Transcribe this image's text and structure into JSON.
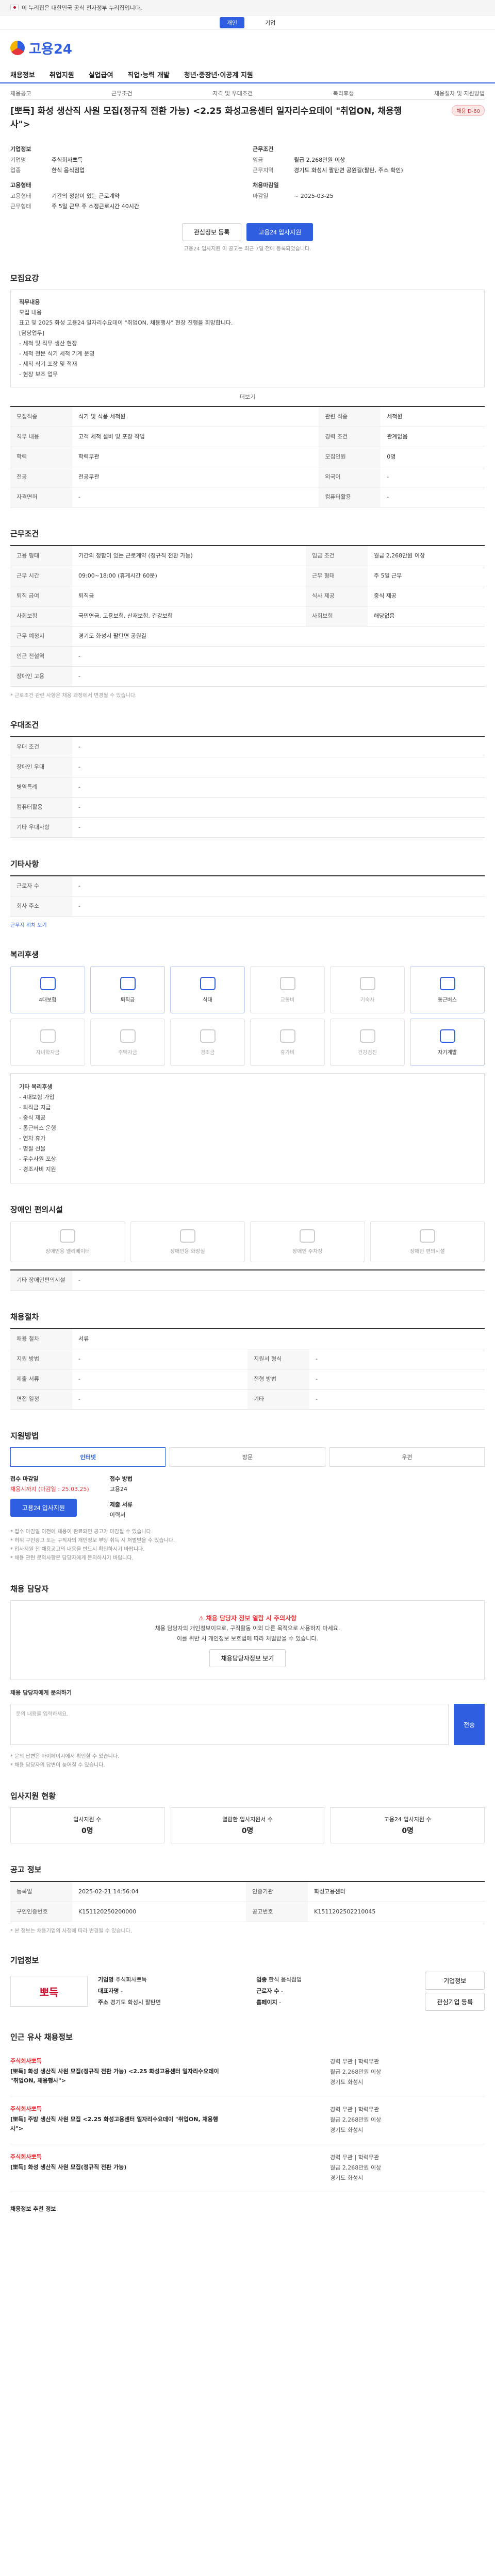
{
  "govbar": {
    "text": "이 누리집은 대한민국 공식 전자정부 누리집입니다."
  },
  "toggle": {
    "left": "개인",
    "right": "기업"
  },
  "logo": {
    "text": "고용24"
  },
  "nav": [
    "채용정보",
    "취업지원",
    "실업급여",
    "직업·능력 개발",
    "청년·중장년·이공계 지원"
  ],
  "top_tabs": [
    "채용공고",
    "근무조건",
    "자격 및 우대조건",
    "복리후생",
    "채용절차 및 지원방법"
  ],
  "job": {
    "title": "[뽀득] 화성 생산직 사원 모집(정규직 전환 가능) <2.25 화성고용센터 일자리수요데이 \"취업ON, 채용행사\">",
    "badge": "채용 D-60",
    "company_label": "기업정보",
    "company": [
      {
        "k": "기업명",
        "v": "주식회사뽀득"
      },
      {
        "k": "업종",
        "v": "한식 음식점업"
      }
    ],
    "cond_label": "근무조건",
    "cond": [
      {
        "k": "임금",
        "v": "월급 2,268만원 이상"
      },
      {
        "k": "근무지역",
        "v": "경기도 화성시 팔탄면 공원길(팔탄, 주소 확인)"
      }
    ],
    "recruit_label": "고용형태",
    "recruit": [
      {
        "k": "고용형태",
        "v": "기간의 정함이 있는 근로계약"
      },
      {
        "k": "근무형태",
        "v": "주 5일 근무 주 소정근로시간 40시간"
      }
    ],
    "deadline_label": "채용마감일",
    "deadline": [
      {
        "k": "마감일",
        "v": "~ 2025-03-25"
      }
    ]
  },
  "buttons": {
    "scrap": "관심정보 등록",
    "apply": "고용24 입사지원",
    "note": "고용24 입사지원 이 공고는 최근 7일 전에 등록되었습니다."
  },
  "detail": {
    "title": "모집요강",
    "sub": "직무내용",
    "lines": [
      "모집 내용",
      "표고 및 2025 화성 고용24 일자리수요데이 \"취업ON, 채용행사\" 현장 진행을 희망합니다.",
      "[담당업무]",
      "- 세척 및 직무 생산 현장",
      "- 세척 전문 식기 세척 기계 운영",
      "- 세척 식기 포장 및 적재",
      "- 현장 보조 업무"
    ],
    "more": "더보기"
  },
  "recruit_table": {
    "rows": [
      {
        "k": "모집직종",
        "v": "식기 및 식품 세척원",
        "k2": "관련 직종",
        "v2": "세척원"
      },
      {
        "k": "직무 내용",
        "v": "고객 세척 설비 및 포장 작업",
        "k2": "경력 조건",
        "v2": "관계없음"
      },
      {
        "k": "학력",
        "v": "학력무관",
        "k2": "모집인원",
        "v2": "0명"
      },
      {
        "k": "전공",
        "v": "전공무관",
        "k2": "외국어",
        "v2": "-"
      },
      {
        "k": "자격면허",
        "v": "-",
        "k2": "컴퓨터활용",
        "v2": "-"
      }
    ]
  },
  "work": {
    "title": "근무조건",
    "rows": [
      {
        "k": "고용 형태",
        "v": "기간의 정함이 있는 근로계약 (정규직 전환 가능)",
        "k2": "임금 조건",
        "v2": "월급 2,268만원 이상"
      },
      {
        "k": "근무 시간",
        "v": "09:00~18:00 (휴게시간 60분)",
        "k2": "근무 형태",
        "v2": "주 5일 근무"
      },
      {
        "k": "퇴직 급여",
        "v": "퇴직금",
        "k2": "식사 제공",
        "v2": "중식 제공"
      },
      {
        "k": "사회보험",
        "v": "국민연금, 고용보험, 산재보험, 건강보험",
        "k2": "사회보험",
        "v2": "해당없음"
      },
      {
        "k": "근무 예정지",
        "v": "경기도 화성시 팔탄면 공원길",
        "k2": "",
        "v2": ""
      },
      {
        "k": "인근 전철역",
        "v": "-",
        "k2": "",
        "v2": ""
      },
      {
        "k": "장애인 고용",
        "v": "-",
        "k2": "",
        "v2": ""
      }
    ],
    "note": "* 근로조건 관련 사항은 채용 과정에서 변경될 수 있습니다."
  },
  "qual": {
    "title": "우대조건",
    "rows": [
      {
        "k": "우대 조건",
        "v": "-"
      },
      {
        "k": "장애인 우대",
        "v": "-"
      },
      {
        "k": "병역특례",
        "v": "-"
      },
      {
        "k": "컴퓨터활용",
        "v": "-"
      },
      {
        "k": "기타 우대사항",
        "v": "-"
      }
    ]
  },
  "extra": {
    "title": "기타사항",
    "rows": [
      {
        "k": "근로자 수",
        "v": "-"
      },
      {
        "k": "회사 주소",
        "v": "-"
      }
    ],
    "link": "근무지 위치 보기"
  },
  "welfare": {
    "title": "복리후생",
    "items": [
      {
        "label": "4대보험",
        "on": true
      },
      {
        "label": "퇴직금",
        "on": true
      },
      {
        "label": "식대",
        "on": true
      },
      {
        "label": "교통비",
        "on": false
      },
      {
        "label": "기숙사",
        "on": false
      },
      {
        "label": "통근버스",
        "on": true
      },
      {
        "label": "자녀학자금",
        "on": false
      },
      {
        "label": "주택자금",
        "on": false
      },
      {
        "label": "경조금",
        "on": false
      },
      {
        "label": "휴가비",
        "on": false
      },
      {
        "label": "건강검진",
        "on": false
      },
      {
        "label": "자기계발",
        "on": true
      }
    ],
    "list_title": "기타 복리후생",
    "list": [
      "- 4대보험 가입",
      "- 퇴직금 지급",
      "- 중식 제공",
      "- 통근버스 운행",
      "- 연차 휴가",
      "- 명절 선물",
      "- 우수사원 포상",
      "- 경조사비 지원"
    ]
  },
  "facility": {
    "title": "장애인 편의시설",
    "items": [
      "장애인용 엘리베이터",
      "장애인용 화장실",
      "장애인 주차장",
      "장애인 편의시설"
    ],
    "other_label": "기타 장애인편의시설",
    "other_value": "-"
  },
  "process": {
    "title": "채용절차",
    "rows": [
      {
        "k": "채용 절차",
        "v": "서류"
      },
      {
        "k": "지원 방법",
        "v": "-",
        "k2": "지원서 형식",
        "v2": "-"
      },
      {
        "k": "제출 서류",
        "v": "-",
        "k2": "전형 방법",
        "v2": "-"
      },
      {
        "k": "면접 일정",
        "v": "-",
        "k2": "기타",
        "v2": "-"
      }
    ]
  },
  "apply": {
    "title": "지원방법",
    "tabs": [
      "인터넷",
      "방문",
      "우편"
    ],
    "col1_label": "접수 마감일",
    "col1_value": "채용시까지 (마감일 : 25.03.25)",
    "col1_btn": "고용24 입사지원",
    "col2_label": "접수 방법",
    "col2_value": "고용24",
    "col3_label": "제출 서류",
    "col3_value": "이력서",
    "notes": [
      "* 접수 마감일 이전에 채용이 완료되면 공고가 마감될 수 있습니다.",
      "* 허위 구인광고 또는 구직자의 개인정보 부당 취득 시 처벌받을 수 있습니다.",
      "* 입사지원 전 채용공고의 내용을 반드시 확인하시기 바랍니다.",
      "* 채용 관련 문의사항은 담당자에게 문의하시기 바랍니다."
    ]
  },
  "contact": {
    "title": "채용 담당자",
    "warn_title": "채용 담당자 정보 열람 시 주의사항",
    "warn_lines": [
      "채용 담당자의 개인정보이므로, 구직활동 이외 다른 목적으로 사용하지 마세요.",
      "이를 위반 시 개인정보 보호법에 따라 처벌받을 수 있습니다."
    ],
    "warn_btn": "채용담당자정보 보기",
    "inquiry_title": "채용 담당자에게 문의하기",
    "inquiry_placeholder": "문의 내용을 입력하세요.",
    "send": "전송",
    "inquiry_notes": [
      "* 문의 답변은 마이페이지에서 확인할 수 있습니다.",
      "* 채용 담당자의 답변이 늦어질 수 있습니다."
    ]
  },
  "status": {
    "title": "입사지원 현황",
    "items": [
      {
        "label": "입사지원 수",
        "value": "0명"
      },
      {
        "label": "열람한 입사지원서 수",
        "value": "0명"
      },
      {
        "label": "고용24 입사지원 수",
        "value": "0명"
      }
    ]
  },
  "posting": {
    "title": "공고 정보",
    "rows": [
      {
        "k": "등록일",
        "v": "2025-02-21 14:56:04",
        "k2": "인증기관",
        "v2": "화성고용센터"
      },
      {
        "k": "구인인증번호",
        "v": "K151120250200000",
        "k2": "공고번호",
        "v2": "K1511202502210045"
      }
    ],
    "note": "* 본 정보는 채용기업의 사정에 따라 변경될 수 있습니다."
  },
  "company": {
    "title": "기업정보",
    "logo": "뽀득",
    "rows": [
      {
        "k": "기업명",
        "v": "주식회사뽀득"
      },
      {
        "k": "업종",
        "v": "한식 음식점업"
      },
      {
        "k": "대표자명",
        "v": "-"
      },
      {
        "k": "근로자 수",
        "v": "-"
      },
      {
        "k": "주소",
        "v": "경기도 화성시 팔탄면"
      },
      {
        "k": "홈페이지",
        "v": "-"
      }
    ],
    "btn1": "기업정보",
    "btn2": "관심기업 등록"
  },
  "similar": {
    "title": "인근 유사 채용정보",
    "items": [
      {
        "company": "주식회사뽀득",
        "title": "[뽀득] 화성 생산직 사원 모집(정규직 전환 가능) <2.25 화성고용센터 일자리수요데이 \"취업ON, 채용행사\">",
        "meta": [
          "경력 무관 | 학력무관",
          "월급 2,268만원 이상",
          "경기도 화성시"
        ]
      },
      {
        "company": "주식회사뽀득",
        "title": "[뽀득] 주방 생산직 사원 모집 <2.25 화성고용센터 일자리수요데이 \"취업ON, 채용행사\">",
        "meta": [
          "경력 무관 | 학력무관",
          "월급 2,268만원 이상",
          "경기도 화성시"
        ]
      },
      {
        "company": "주식회사뽀득",
        "title": "[뽀득] 화성 생산직 사원 모집(정규직 전환 가능)",
        "meta": [
          "경력 무관 | 학력무관",
          "월급 2,268만원 이상",
          "경기도 화성시"
        ]
      }
    ],
    "footer": "채용정보 추천 정보"
  }
}
